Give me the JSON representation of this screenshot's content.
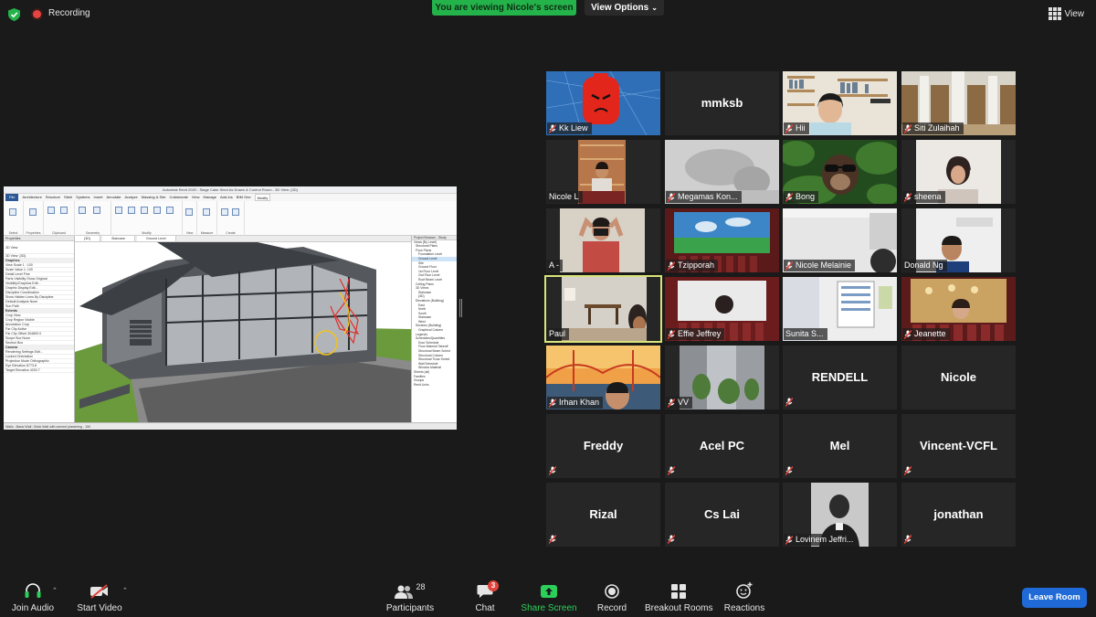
{
  "topbar": {
    "recording_label": "Recording",
    "viewing_label": "You are viewing Nicole's screen",
    "view_options_label": "View Options",
    "view_label": "View"
  },
  "shared_screen": {
    "window_title": "Autodesk Revit 2020 - Stage Cake Shed As Drawn & Control Room - 3D View: {3D}",
    "menu": [
      "File",
      "Architecture",
      "Structure",
      "Steel",
      "Systems",
      "Insert",
      "Annotate",
      "Analyze",
      "Massing & Site",
      "Collaborate",
      "View",
      "Manage",
      "Add-Ins",
      "BIM One",
      "Modify"
    ],
    "ribbon_groups": [
      "Select",
      "Properties",
      "Clipboard",
      "Geometry",
      "Modify",
      "View",
      "Measure",
      "Create"
    ],
    "view_tabs": [
      "{3D}",
      "Staircase",
      "Ground Level"
    ],
    "properties_title": "Properties",
    "properties_rows": [
      "3D View",
      "3D View: {3D}",
      "Graphics",
      "View Scale  1 : 100",
      "Scale Value 1: 100",
      "Detail Level  Fine",
      "Parts Visibility  Show Original",
      "Visibility/Graphics  Edit...",
      "Graphic Display  Edit...",
      "Discipline  Coordination",
      "Show Hidden Lines  By Discipline",
      "Default Analysis  None",
      "Sun Path",
      "Extents",
      "Crop View",
      "Crop Region Visible",
      "Annotation Crop",
      "Far Clip Active",
      "Far Clip Offset  304800.0",
      "Scope Box  None",
      "Section Box",
      "Camera",
      "Rendering Settings  Edit...",
      "Locked Orientation",
      "Projection Mode  Orthographic",
      "Eye Elevation  8773.8",
      "Target Elevation  4202.7"
    ],
    "browser_title": "Project Browser - Study",
    "browser_items": [
      "Views (By Level)",
      "Structural Plans",
      "Floor Plans",
      "Foundation Level",
      "Ground Level",
      "Site",
      "Ground Floor",
      "1st Floor Level",
      "2nd Floor Level",
      "Roof Beam Level",
      "Ceiling Plans",
      "3D Views",
      "Staircase",
      "{3D}",
      "Elevations (Building)",
      "East",
      "North",
      "South",
      "Staircase",
      "West",
      "Sections (Building)",
      "Graphical Column",
      "Legends",
      "Schedules/Quantities",
      "Door Schedule",
      "Floor Material Takeoff",
      "Structural Beam Sched",
      "Structural Column",
      "Structural Truss Sched",
      "Wall Schedule",
      "Window Material",
      "Sheets (all)",
      "Families",
      "Groups",
      "Revit Links"
    ],
    "status_text": "Walls : Basic Wall : Brick Wall with cement plastering - 150"
  },
  "participants": [
    {
      "name": "Kk Liew",
      "label_type": "overlay",
      "muted": true
    },
    {
      "name": "mmksb",
      "label_type": "center",
      "muted": false
    },
    {
      "name": "Hii",
      "label_type": "overlay",
      "muted": true
    },
    {
      "name": "Siti Zulaihah",
      "label_type": "overlay",
      "muted": true
    },
    {
      "name": "Nicole L",
      "label_type": "overlay",
      "muted": false
    },
    {
      "name": "Megamas Kon...",
      "label_type": "overlay",
      "muted": true
    },
    {
      "name": "Bong",
      "label_type": "overlay",
      "muted": true
    },
    {
      "name": "sheena",
      "label_type": "overlay",
      "muted": true
    },
    {
      "name": "A -",
      "label_type": "overlay",
      "muted": false
    },
    {
      "name": "Tzipporah",
      "label_type": "overlay",
      "muted": true
    },
    {
      "name": "Nicole Melainie",
      "label_type": "overlay",
      "muted": true
    },
    {
      "name": "Donald Ng",
      "label_type": "overlay",
      "muted": false
    },
    {
      "name": "Paul",
      "label_type": "overlay",
      "muted": false
    },
    {
      "name": "Effie Jeffrey",
      "label_type": "overlay",
      "muted": true
    },
    {
      "name": "Sunita S...",
      "label_type": "overlay",
      "muted": false
    },
    {
      "name": "Jeanette",
      "label_type": "overlay",
      "muted": true
    },
    {
      "name": "Irhan Khan",
      "label_type": "overlay",
      "muted": true
    },
    {
      "name": "VV",
      "label_type": "overlay",
      "muted": true
    },
    {
      "name": "RENDELL",
      "label_type": "center",
      "muted": true
    },
    {
      "name": "Nicole",
      "label_type": "center",
      "muted": false
    },
    {
      "name": "Freddy",
      "label_type": "center",
      "muted": true
    },
    {
      "name": "Acel PC",
      "label_type": "center",
      "muted": true
    },
    {
      "name": "Mel",
      "label_type": "center",
      "muted": true
    },
    {
      "name": "Vincent-VCFL",
      "label_type": "center",
      "muted": true
    },
    {
      "name": "Rizal",
      "label_type": "center",
      "muted": true
    },
    {
      "name": "Cs Lai",
      "label_type": "center",
      "muted": true
    },
    {
      "name": "Lovinem Jeffri...",
      "label_type": "overlay",
      "muted": true
    },
    {
      "name": "jonathan",
      "label_type": "center",
      "muted": true
    }
  ],
  "toolbar": {
    "join_audio": "Join Audio",
    "start_video": "Start Video",
    "participants": "Participants",
    "participants_count": "28",
    "chat": "Chat",
    "chat_badge": "3",
    "share_screen": "Share Screen",
    "record": "Record",
    "breakout_rooms": "Breakout Rooms",
    "reactions": "Reactions",
    "leave_room": "Leave Room"
  },
  "colors": {
    "viewing_bar": "#24b24b",
    "active_speaker_border": "#d8e47a",
    "leave_button": "#1f6ad6",
    "muted_icon": "#e2423b",
    "background": "#1a1a1a"
  }
}
